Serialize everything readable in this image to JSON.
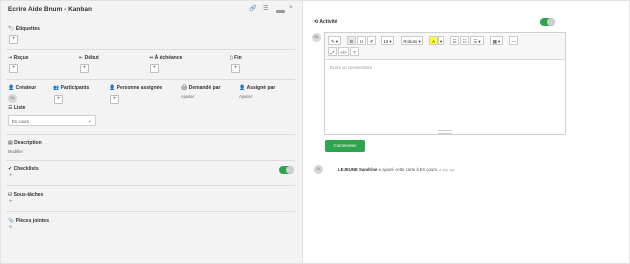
{
  "header": {
    "title": "Ecrire Aide Bnum - Kanban"
  },
  "labels": {
    "title": "Étiquettes"
  },
  "dates": {
    "received": "Reçue",
    "start": "Début",
    "due": "À échéance",
    "end": "Fin"
  },
  "people": {
    "creator": "Créateur",
    "creator_avatar": "SL",
    "participants": "Participants",
    "assigned_person": "Personne assignée",
    "requested_by": "Demandé par",
    "requested_by_value": "Ajouter",
    "assigned_by": "Assigné par",
    "assigned_by_value": "Ajouter"
  },
  "list": {
    "title": "Liste",
    "selected": "En cours"
  },
  "description": {
    "title": "Description",
    "action": "Modifier"
  },
  "checklists": {
    "title": "Checklists",
    "add": "+"
  },
  "subtasks": {
    "title": "Sous-tâches",
    "add": "+"
  },
  "attachments": {
    "title": "Pièces jointes",
    "add": "+"
  },
  "activity": {
    "title": "Activité",
    "user_avatar": "SL",
    "editor": {
      "style": "✎ ▾",
      "bold": "B",
      "underline": "U",
      "eraser": "✐",
      "font_size": "13 ▾",
      "font_name": "Roboto ▾",
      "color": "A",
      "color_caret": "▾",
      "ul": "☰",
      "ol": "☷",
      "align": "☰ ▾",
      "table": "▦ ▾",
      "hr": "—",
      "fullscreen": "⤢",
      "code": "</>",
      "help": "?",
      "placeholder": "Écrire un commentaire"
    },
    "submit": "Commenter",
    "feed": {
      "avatar": "SL",
      "user": "LEJEUNE Sandrine",
      "text": "a ajouté cette carte à En cours.",
      "time": "a day ago"
    }
  },
  "colors": {
    "accent": "#2fa44f",
    "left_panel": "#f3f3f3"
  }
}
